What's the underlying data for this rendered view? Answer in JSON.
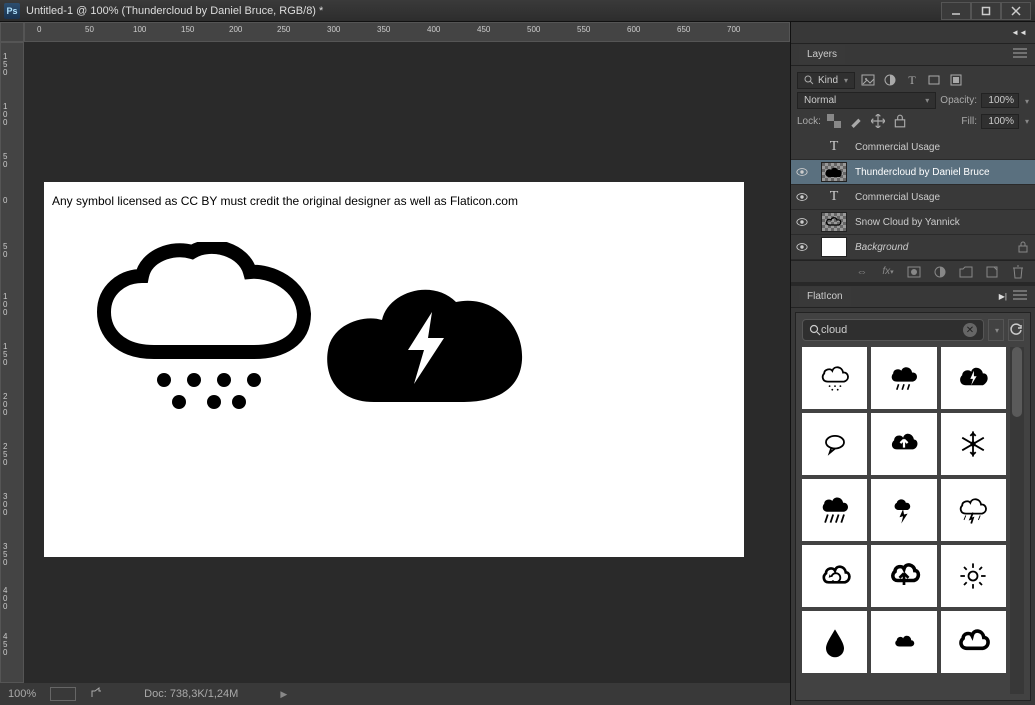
{
  "title": "Untitled-1 @ 100% (Thundercloud by Daniel Bruce, RGB/8) *",
  "canvas_caption": "Any symbol licensed as CC BY must credit the original designer as well as Flaticon.com",
  "statusbar": {
    "zoom": "100%",
    "doc": "Doc: 738,3K/1,24M"
  },
  "layers_panel": {
    "title": "Layers",
    "kind": "Kind",
    "blend_mode": "Normal",
    "opacity_label": "Opacity:",
    "opacity_value": "100%",
    "lock_label": "Lock:",
    "fill_label": "Fill:",
    "fill_value": "100%",
    "layers": [
      {
        "name": "Commercial Usage",
        "type": "text",
        "visible": false
      },
      {
        "name": "Thundercloud by Daniel Bruce",
        "type": "thumb",
        "visible": true,
        "selected": true
      },
      {
        "name": "Commercial Usage",
        "type": "text",
        "visible": true
      },
      {
        "name": "Snow Cloud by Yannick",
        "type": "thumb",
        "visible": true
      },
      {
        "name": "Background",
        "type": "bg",
        "visible": true,
        "locked": true
      }
    ]
  },
  "flaticon": {
    "title": "FlatIcon",
    "search_value": "cloud"
  }
}
